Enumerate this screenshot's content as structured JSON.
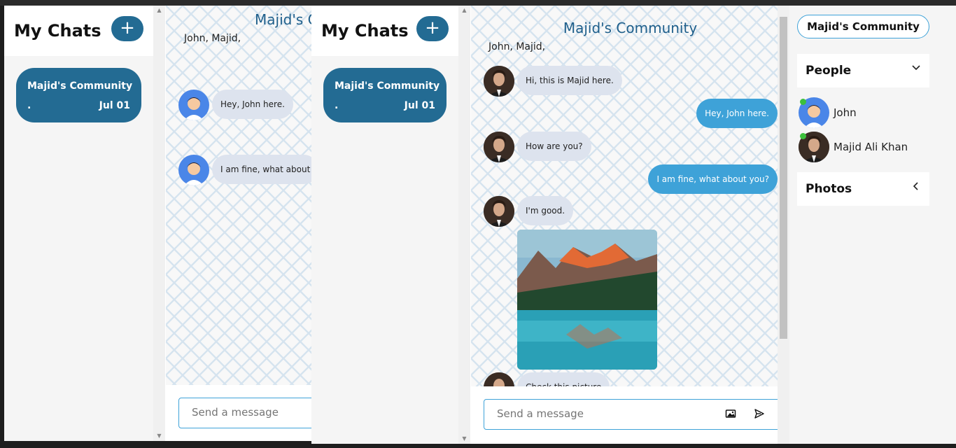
{
  "sidebar": {
    "title": "My Chats",
    "add_label": "+"
  },
  "chat_card": {
    "name": "Majid's Community",
    "preview": ".",
    "date": "Jul 01"
  },
  "chat": {
    "title": "Majid's Community",
    "back_title": "Majid's C",
    "members": "John,  Majid,",
    "back_messages": [
      "Hey, John here.",
      "I am fine, what about"
    ],
    "messages": [
      {
        "from": "majid",
        "text": "Hi, this is Majid here."
      },
      {
        "from": "me",
        "text": "Hey, John here."
      },
      {
        "from": "majid",
        "text": "How are you?"
      },
      {
        "from": "me",
        "text": "I am fine, what about you?"
      },
      {
        "from": "majid",
        "text": "I'm good."
      },
      {
        "from": "majid",
        "text": "Check this picture"
      }
    ],
    "input_placeholder": "Send a message"
  },
  "right_panel": {
    "pill": "Majid's Community",
    "people_label": "People",
    "people": [
      "John",
      "Majid Ali Khan"
    ],
    "photos_label": "Photos"
  },
  "colors": {
    "accent": "#236b93",
    "bubble_out": "#3ea2d8",
    "bubble_in": "#dde3ee",
    "title": "#1f5f8b"
  },
  "icons": {
    "add": "plus-icon",
    "image": "image-icon",
    "send": "send-icon",
    "people_toggle": "chevron-down-icon",
    "photos_toggle": "chevron-left-icon"
  }
}
